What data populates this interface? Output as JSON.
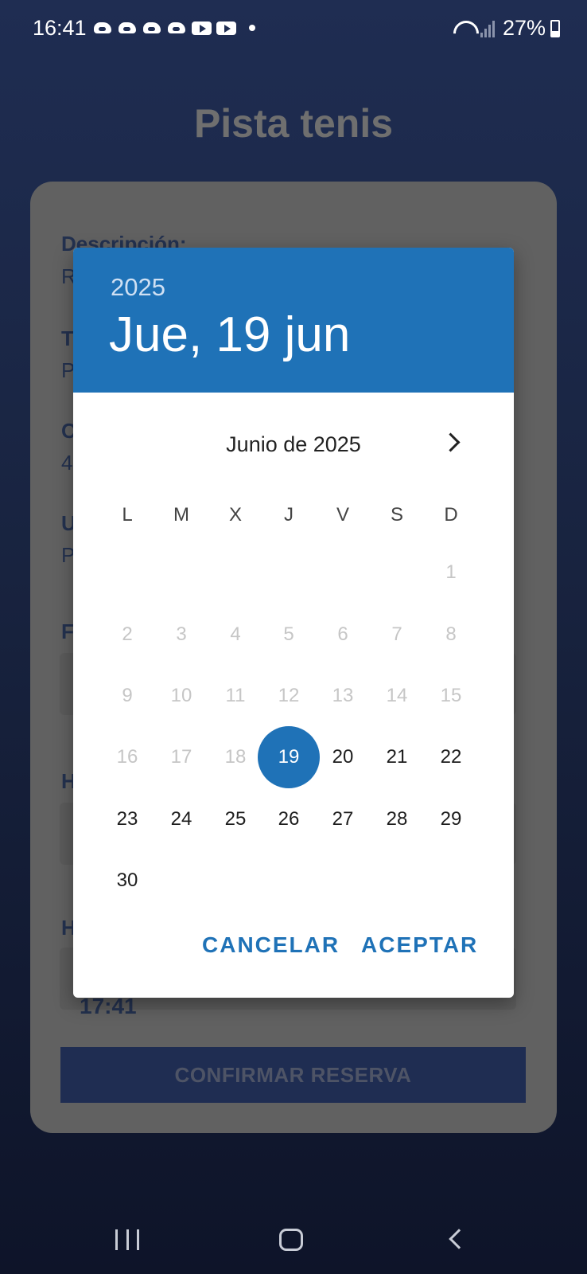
{
  "status_bar": {
    "time": "16:41",
    "battery": "27%",
    "notification_icons": [
      "cloud-app-icon",
      "cloud-app-icon",
      "cloud-app-icon",
      "cloud-app-icon",
      "youtube-icon",
      "youtube-icon",
      "dot-icon"
    ]
  },
  "page": {
    "title": "Pista tenis",
    "fields": [
      {
        "label": "Descripción:",
        "value": "R"
      },
      {
        "label": "T",
        "value": "P"
      },
      {
        "label": "C",
        "value": "4"
      },
      {
        "label": "U",
        "value": "P"
      },
      {
        "label": "F"
      },
      {
        "label": "H"
      },
      {
        "label": "H",
        "value": "17:41"
      }
    ],
    "confirm_button": "CONFIRMAR RESERVA"
  },
  "date_picker": {
    "header_year": "2025",
    "header_date": "Jue, 19 jun",
    "month_label": "Junio de 2025",
    "weekdays": [
      "L",
      "M",
      "X",
      "J",
      "V",
      "S",
      "D"
    ],
    "first_day_column": 6,
    "days_in_month": 30,
    "selected_day": 19,
    "first_enabled_day": 19,
    "cancel_label": "CANCELAR",
    "accept_label": "ACEPTAR",
    "accent_color": "#1f72b7"
  }
}
